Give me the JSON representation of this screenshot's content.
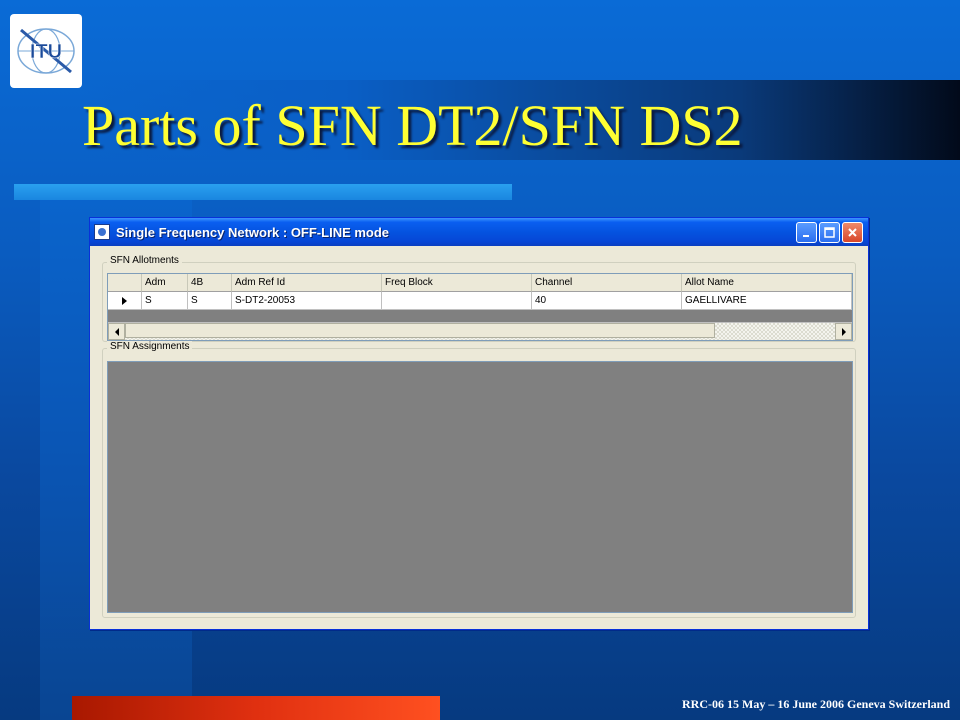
{
  "slide": {
    "title": "Parts of SFN DT2/SFN DS2",
    "footer": "RRC-06 15 May – 16 June 2006 Geneva Switzerland",
    "logo_text": "ITU"
  },
  "window": {
    "title": "Single Frequency Network : OFF-LINE mode",
    "buttons": {
      "minimize": "_",
      "maximize": "□",
      "close": "✕"
    }
  },
  "allotments": {
    "legend": "SFN Allotments",
    "columns": [
      "Adm",
      "4B",
      "Adm Ref Id",
      "Freq Block",
      "Channel",
      "Allot Name"
    ],
    "rows": [
      [
        "S",
        "S",
        "S-DT2-20053",
        "",
        "40",
        "GAELLIVARE"
      ]
    ]
  },
  "assignments": {
    "legend": "SFN Assignments"
  },
  "colors": {
    "title_yellow": "#ffff33",
    "window_border": "#0831d9",
    "grid_background": "#808080"
  },
  "icons": [
    "itu-logo-icon",
    "app-icon",
    "minimize-icon",
    "maximize-icon",
    "close-icon",
    "row-pointer-icon",
    "scroll-left-icon",
    "scroll-right-icon"
  ]
}
